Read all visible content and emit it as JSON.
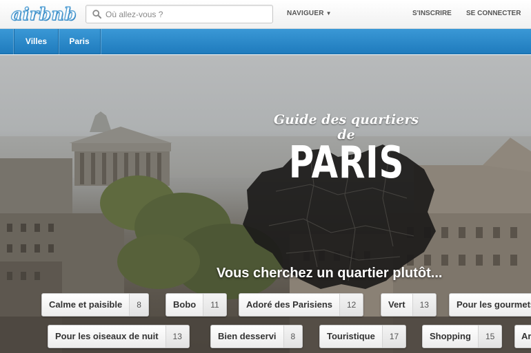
{
  "header": {
    "logo": "airbnb",
    "search_placeholder": "Où allez-vous ?",
    "search_value": "",
    "nav_label": "NAVIGUER",
    "signup_label": "S'INSCRIRE",
    "login_label": "SE CONNECTER"
  },
  "breadcrumb": {
    "items": [
      {
        "label": "Villes"
      },
      {
        "label": "Paris"
      }
    ]
  },
  "hero": {
    "guide_title": "Guide des quartiers de",
    "city": "PARIS",
    "question": "Vous cherchez un quartier plutôt..."
  },
  "tags_row1": [
    {
      "label": "Calme et paisible",
      "count": "8"
    },
    {
      "label": "Bobo",
      "count": "11"
    },
    {
      "label": "Adoré des Parisiens",
      "count": "12"
    },
    {
      "label": "Vert",
      "count": "13"
    },
    {
      "label": "Pour les gourmets",
      "count": ""
    }
  ],
  "tags_row2": [
    {
      "label": "Pour les oiseaux de nuit",
      "count": "13"
    },
    {
      "label": "Bien desservi",
      "count": "8"
    },
    {
      "label": "Touristique",
      "count": "17"
    },
    {
      "label": "Shopping",
      "count": "15"
    },
    {
      "label": "Ar",
      "count": ""
    }
  ],
  "colors": {
    "accent_blue": "#2589cb",
    "logo_blue": "#4a9ad1"
  }
}
